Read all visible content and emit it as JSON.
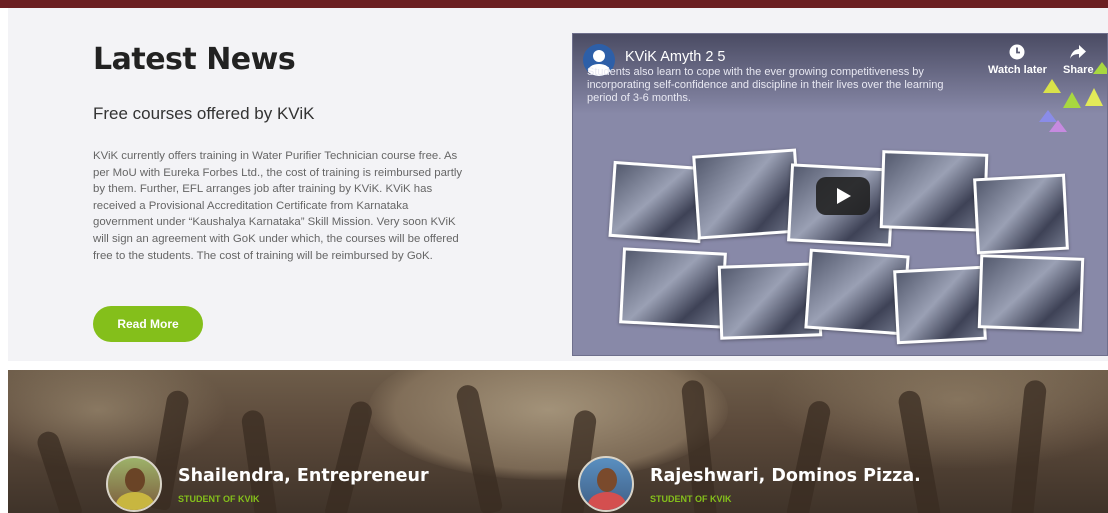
{
  "colors": {
    "accent_green": "#84bf1b",
    "top_bar": "#6b1f22",
    "panel_bg": "#f3f3f6"
  },
  "news": {
    "heading": "Latest News",
    "subheading": "Free courses offered by KViK",
    "body": "KViK currently offers training in Water Purifier Technician course free. As per MoU with Eureka Forbes Ltd., the cost of training is reimbursed partly by them. Further, EFL arranges job after training by KViK. KViK has received a Provisional Accreditation Certificate from Karnataka government under “Kaushalya Karnataka” Skill Mission. Very soon KViK will sign an agreement with GoK under which, the courses will be offered free to the students. The cost of training will be reimbursed by GoK.",
    "read_more_label": "Read More"
  },
  "video": {
    "title": "KViK Amyth 2 5",
    "caption": "Students also learn to cope with the ever growing competitiveness by incorporating self-confidence and discipline in their lives over the learning period of 3-6 months.",
    "watch_later_label": "Watch later",
    "share_label": "Share",
    "watch_later_icon": "clock-icon",
    "share_icon": "share-arrow-icon",
    "play_icon": "play-icon"
  },
  "testimonials": [
    {
      "name": "Shailendra, Entrepreneur",
      "role": "STUDENT OF KVIK"
    },
    {
      "name": "Rajeshwari, Dominos Pizza.",
      "role": "STUDENT OF KVIK"
    }
  ]
}
